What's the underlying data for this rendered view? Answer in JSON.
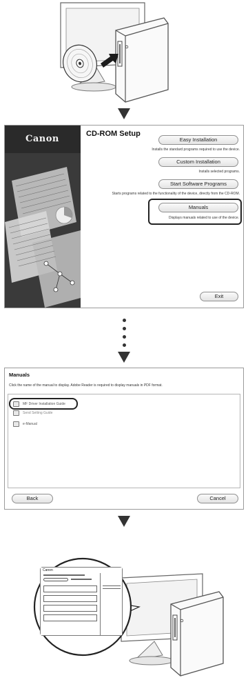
{
  "setup": {
    "brand": "Canon",
    "title": "CD-ROM Setup",
    "buttons": [
      {
        "label": "Easy Installation",
        "desc": "Installs the standard programs required to use the device."
      },
      {
        "label": "Custom Installation",
        "desc": "Installs selected programs."
      },
      {
        "label": "Start Software Programs",
        "desc": "Starts programs related to the functionality of the device, directly from the CD-ROM."
      },
      {
        "label": "Manuals",
        "desc": "Displays manuals related to use of the device."
      }
    ],
    "exit_label": "Exit"
  },
  "manuals": {
    "title": "Manuals",
    "description": "Click the name of the manual to display. Adobe Reader is required to display manuals in PDF format.",
    "items": [
      {
        "label": "MF Driver Installation Guide"
      },
      {
        "label": "Send Setting Guide"
      },
      {
        "label": "e-Manual"
      }
    ],
    "back_label": "Back",
    "cancel_label": "Cancel"
  },
  "zoom_window": {
    "brand": "Canon"
  },
  "colors": {
    "dark_panel": "#2a2a2a",
    "arrow": "#333333",
    "outline": "#222222"
  }
}
